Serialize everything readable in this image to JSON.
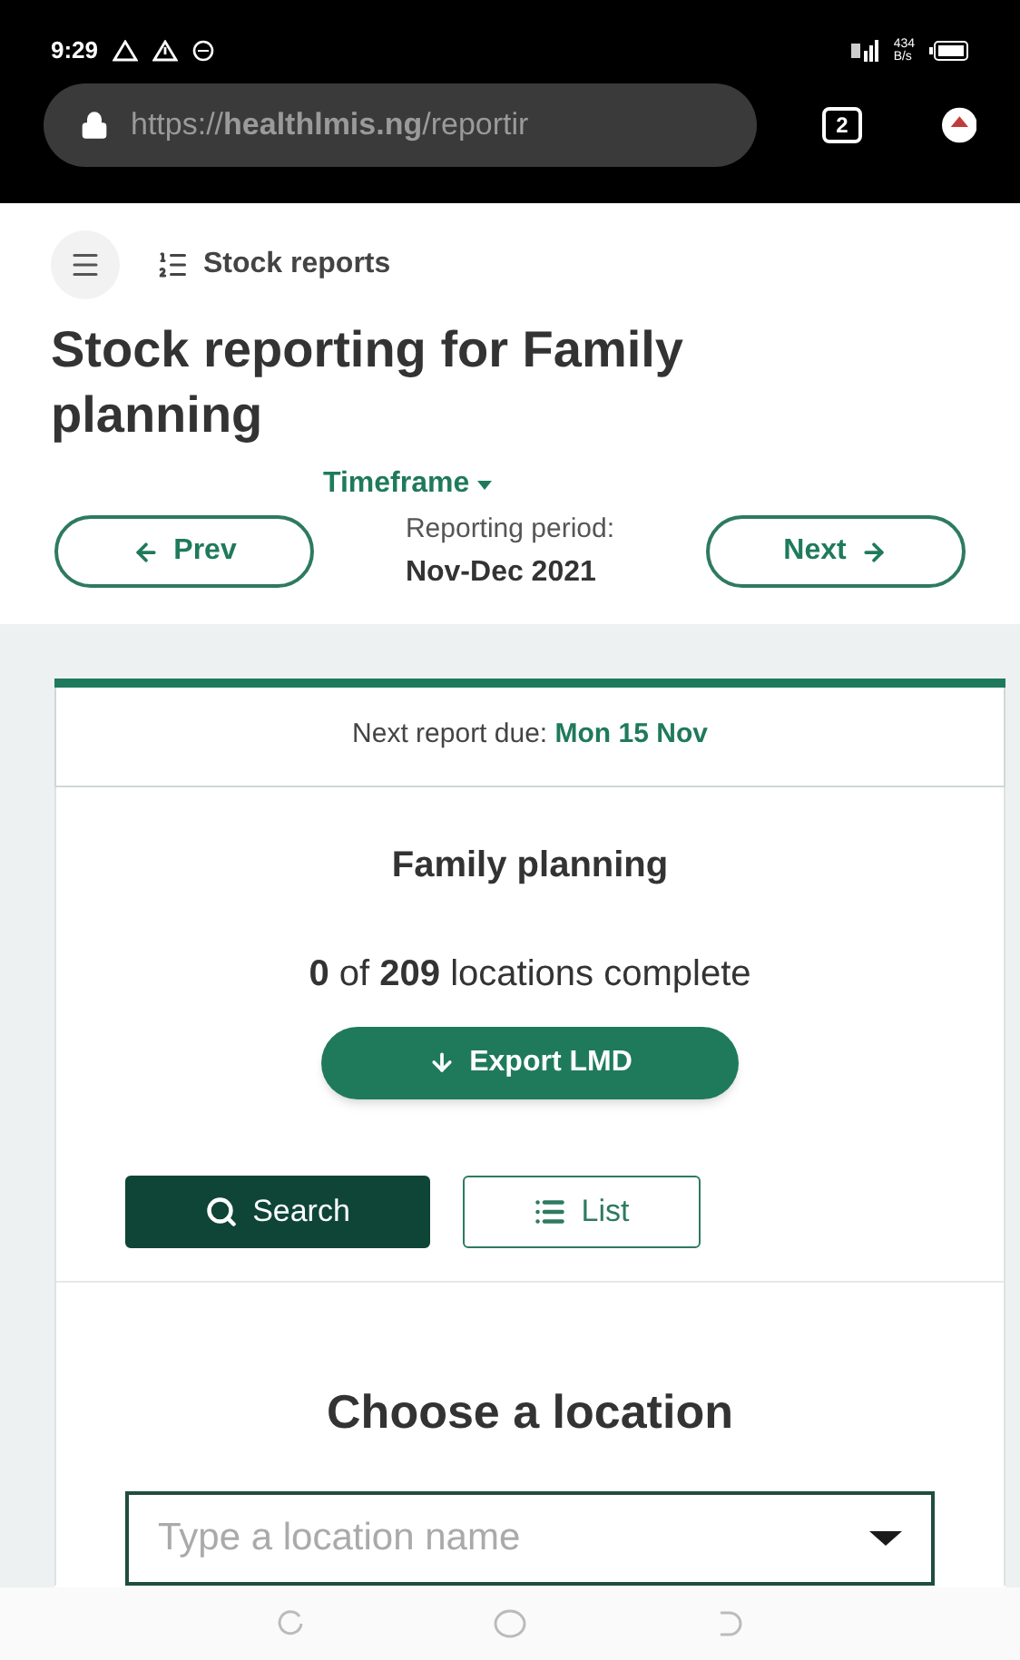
{
  "status_bar": {
    "time": "9:29",
    "speed_value": "434",
    "speed_unit": "B/s"
  },
  "browser": {
    "url": "https://**healthlmis.ng**/reportir",
    "tab_count": "2"
  },
  "nav": {
    "breadcrumb": "Stock reports"
  },
  "title": "Stock reporting for Family planning",
  "timeframe": {
    "label": "Timeframe",
    "prev": "Prev",
    "next": "Next",
    "period_label": "Reporting period:",
    "period": "Nov-Dec 2021"
  },
  "card": {
    "due_label": "Next report due:",
    "due_date": "Mon 15 Nov",
    "program": "Family planning",
    "count_done": "0",
    "count_of": "of",
    "count_total": "209",
    "count_suffix": "locations complete",
    "export": "Export LMD",
    "views": [
      {
        "label": "Search",
        "kind": "search",
        "selected": true
      },
      {
        "label": "List",
        "kind": "list",
        "selected": false
      }
    ],
    "choose_title": "Choose a location",
    "location_field": {
      "placeholder": "Type a location name"
    }
  }
}
